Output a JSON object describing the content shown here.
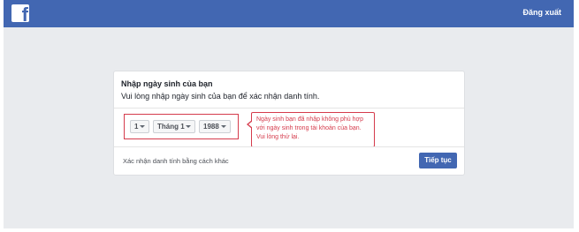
{
  "header": {
    "logo_letter": "f",
    "logout_label": "Đăng xuất"
  },
  "card": {
    "title": "Nhập ngày sinh của bạn",
    "subtitle": "Vui lòng nhập ngày sinh của bạn để xác nhận danh tính.",
    "birthday": {
      "day": "1",
      "month": "Tháng 1",
      "year": "1988"
    },
    "error_tooltip": "Ngày sinh bạn đã nhập không phù hợp với ngày sinh trong tài khoản của bạn. Vui lòng thử lại.",
    "alternate_link": "Xác nhận danh tính bằng cách khác",
    "continue_label": "Tiếp tục"
  },
  "colors": {
    "brand": "#4267b2",
    "error": "#d53b4c",
    "background": "#e9ebee"
  }
}
